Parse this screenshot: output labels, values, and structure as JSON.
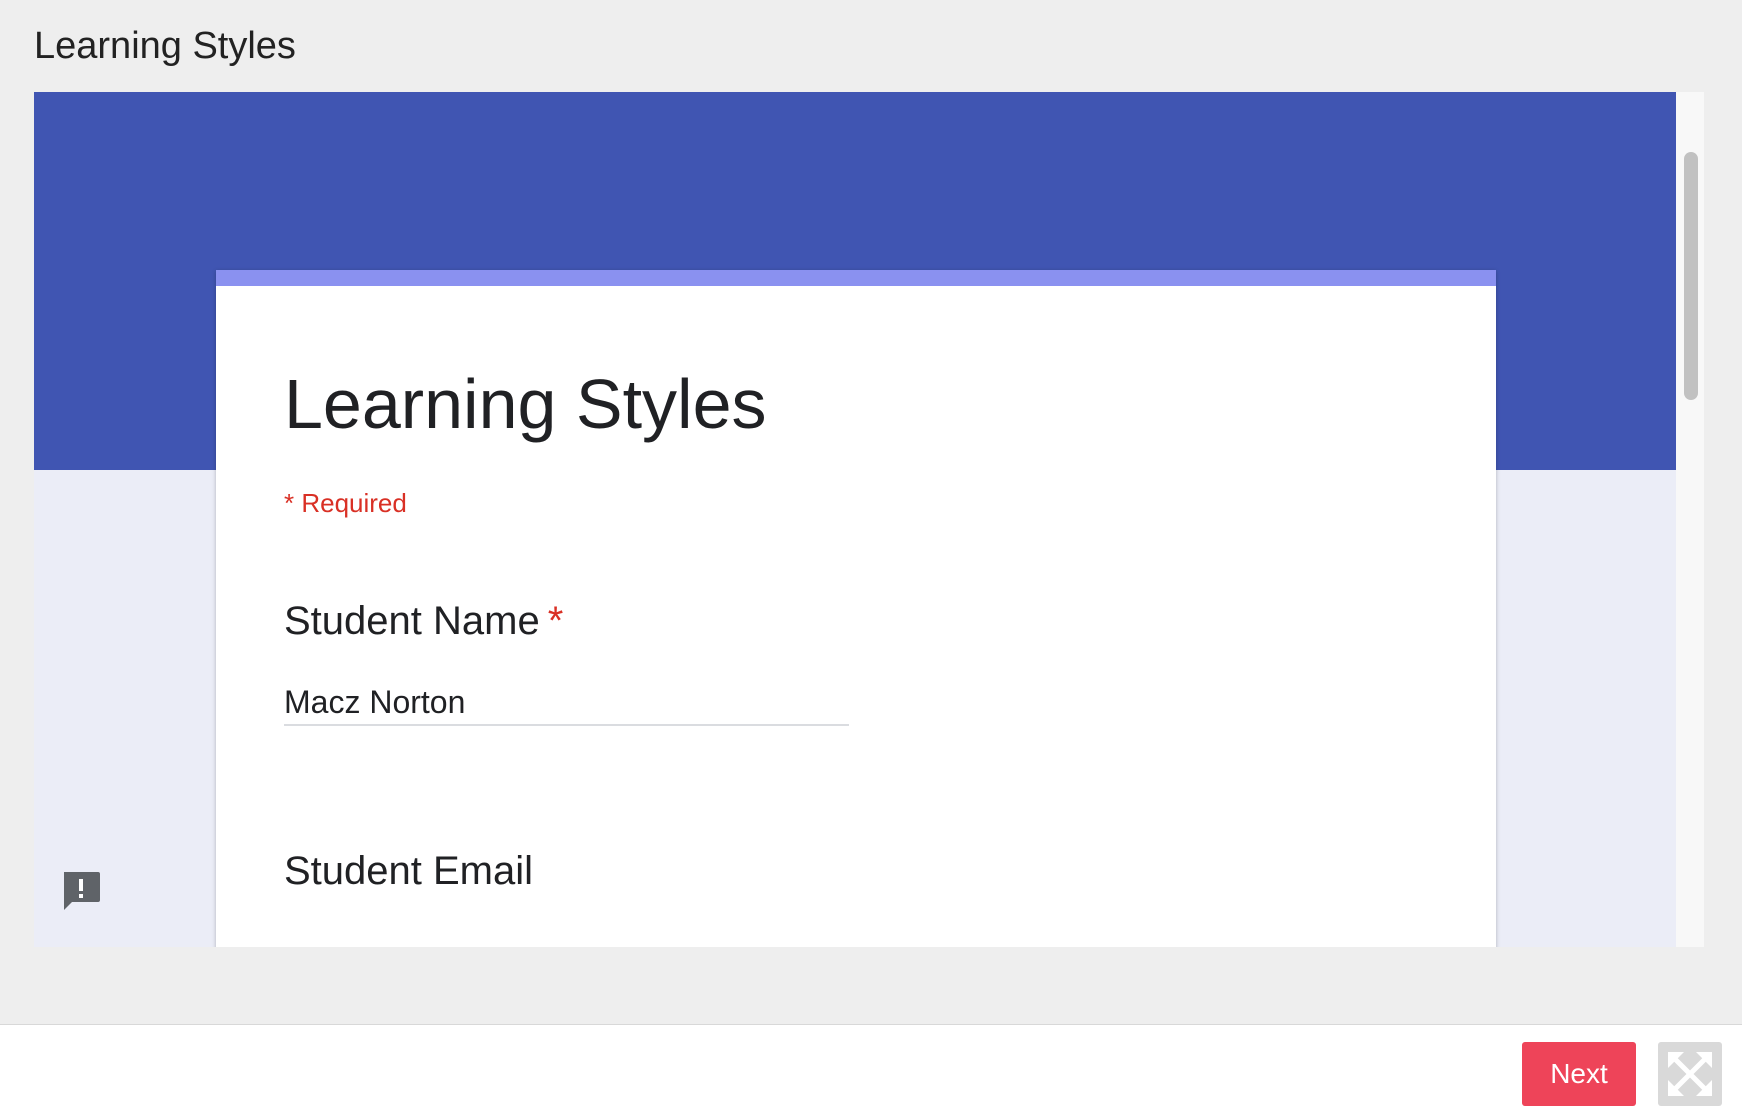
{
  "header": {
    "title": "Learning Styles"
  },
  "form": {
    "title": "Learning Styles",
    "required_note": "* Required",
    "questions": [
      {
        "label": "Student Name",
        "required_marker": "*",
        "answer": "Macz Norton"
      },
      {
        "label": "Student Email"
      }
    ]
  },
  "icons": {
    "feedback": "report-feedback-icon",
    "fullscreen": "fullscreen-icon"
  },
  "colors": {
    "banner": "#4055b2",
    "accent": "#8a91f0",
    "required": "#d93025",
    "next_button": "#ee4459"
  },
  "footer": {
    "next_label": "Next"
  }
}
